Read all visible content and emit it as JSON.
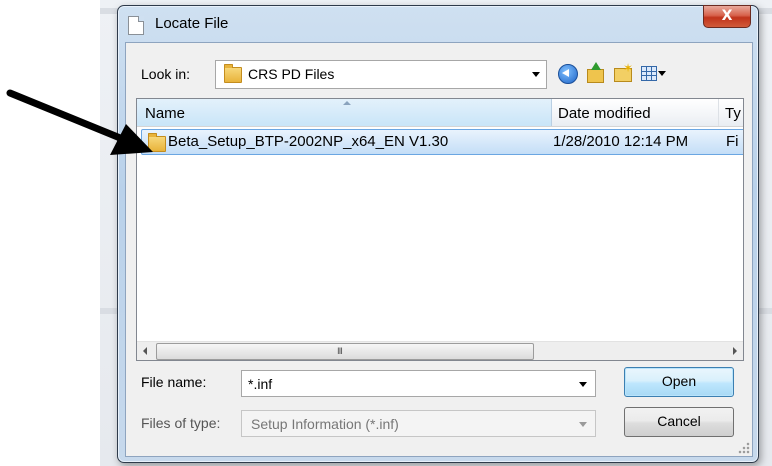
{
  "dialog": {
    "title": "Locate File",
    "close_glyph": "X",
    "title_icon": "document-icon"
  },
  "toolbar": {
    "look_in_label": "Look in:",
    "look_in_value": "CRS PD Files",
    "icons": [
      "back-icon",
      "up-folder-icon",
      "new-folder-icon",
      "views-menu-icon"
    ]
  },
  "file_list": {
    "columns": [
      "Name",
      "Date modified",
      "Ty"
    ],
    "rows": [
      {
        "name": "Beta_Setup_BTP-2002NP_x64_EN V1.30",
        "date_modified": "1/28/2010 12:14 PM",
        "type": "Fi",
        "selected": true
      }
    ],
    "scroll_grip": "III"
  },
  "footer": {
    "file_name_label": "File name:",
    "file_name_value": "*.inf",
    "files_of_type_label": "Files of type:",
    "files_of_type_value": "Setup Information (*.inf)",
    "open_label": "Open",
    "cancel_label": "Cancel"
  },
  "colors": {
    "selection_border": "#6aa6e2",
    "selection_fill": "#c4def7",
    "close_button": "#c0331b",
    "callout_arrow": "#000000"
  }
}
